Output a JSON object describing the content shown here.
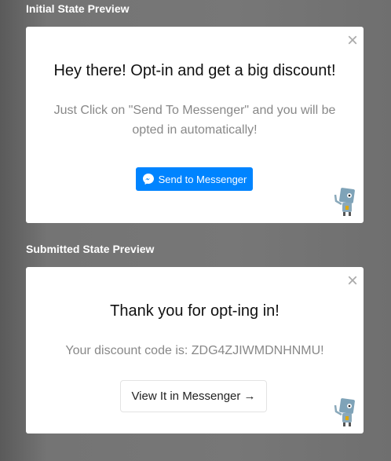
{
  "initial": {
    "section_label": "Initial State Preview",
    "title": "Hey there! Opt-in and get a big discount!",
    "body": "Just Click on \"Send To Messenger\" and you will be opted in automatically!",
    "button_label": "Send to Messenger",
    "close": "×"
  },
  "submitted": {
    "section_label": "Submitted State Preview",
    "title": "Thank you for opt-ing in!",
    "body": "Your discount code is: ZDG4ZJIWMDNHNMU!",
    "button_label": "View It in Messenger →",
    "close": "×"
  },
  "colors": {
    "messenger_blue": "#0084ff"
  }
}
